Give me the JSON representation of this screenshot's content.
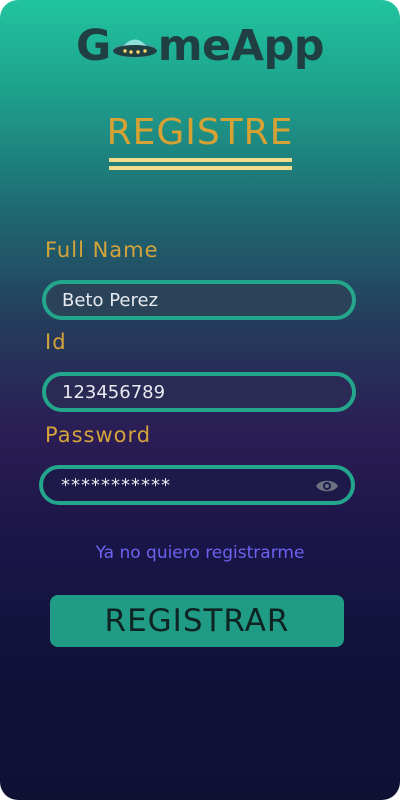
{
  "app": {
    "logo_before": "G",
    "logo_after": "meApp"
  },
  "page": {
    "title": "REGISTRE"
  },
  "form": {
    "full_name_label": "Full Name",
    "full_name_value": "Beto Perez",
    "id_label": "Id",
    "id_value": "123456789",
    "password_label": "Password",
    "password_value": "***********",
    "show_password_icon": "eye-icon"
  },
  "actions": {
    "cancel_link": "Ya no quiero registrarme",
    "register_button": "REGISTRAR"
  },
  "colors": {
    "accent": "#23a68c",
    "label": "#d4a43a",
    "link": "#6d62f0"
  }
}
